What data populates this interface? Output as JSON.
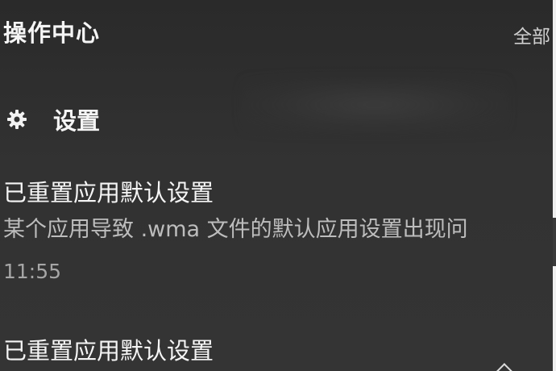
{
  "header": {
    "title": "操作中心",
    "clear_all_label": "全部"
  },
  "group": {
    "icon": "gear-icon",
    "title": "设置"
  },
  "notifications": [
    {
      "title": "已重置应用默认设置",
      "body": "某个应用导致 .wma 文件的默认应用设置出现问",
      "time": "11:55"
    },
    {
      "title": "已重置应用默认设置"
    }
  ]
}
